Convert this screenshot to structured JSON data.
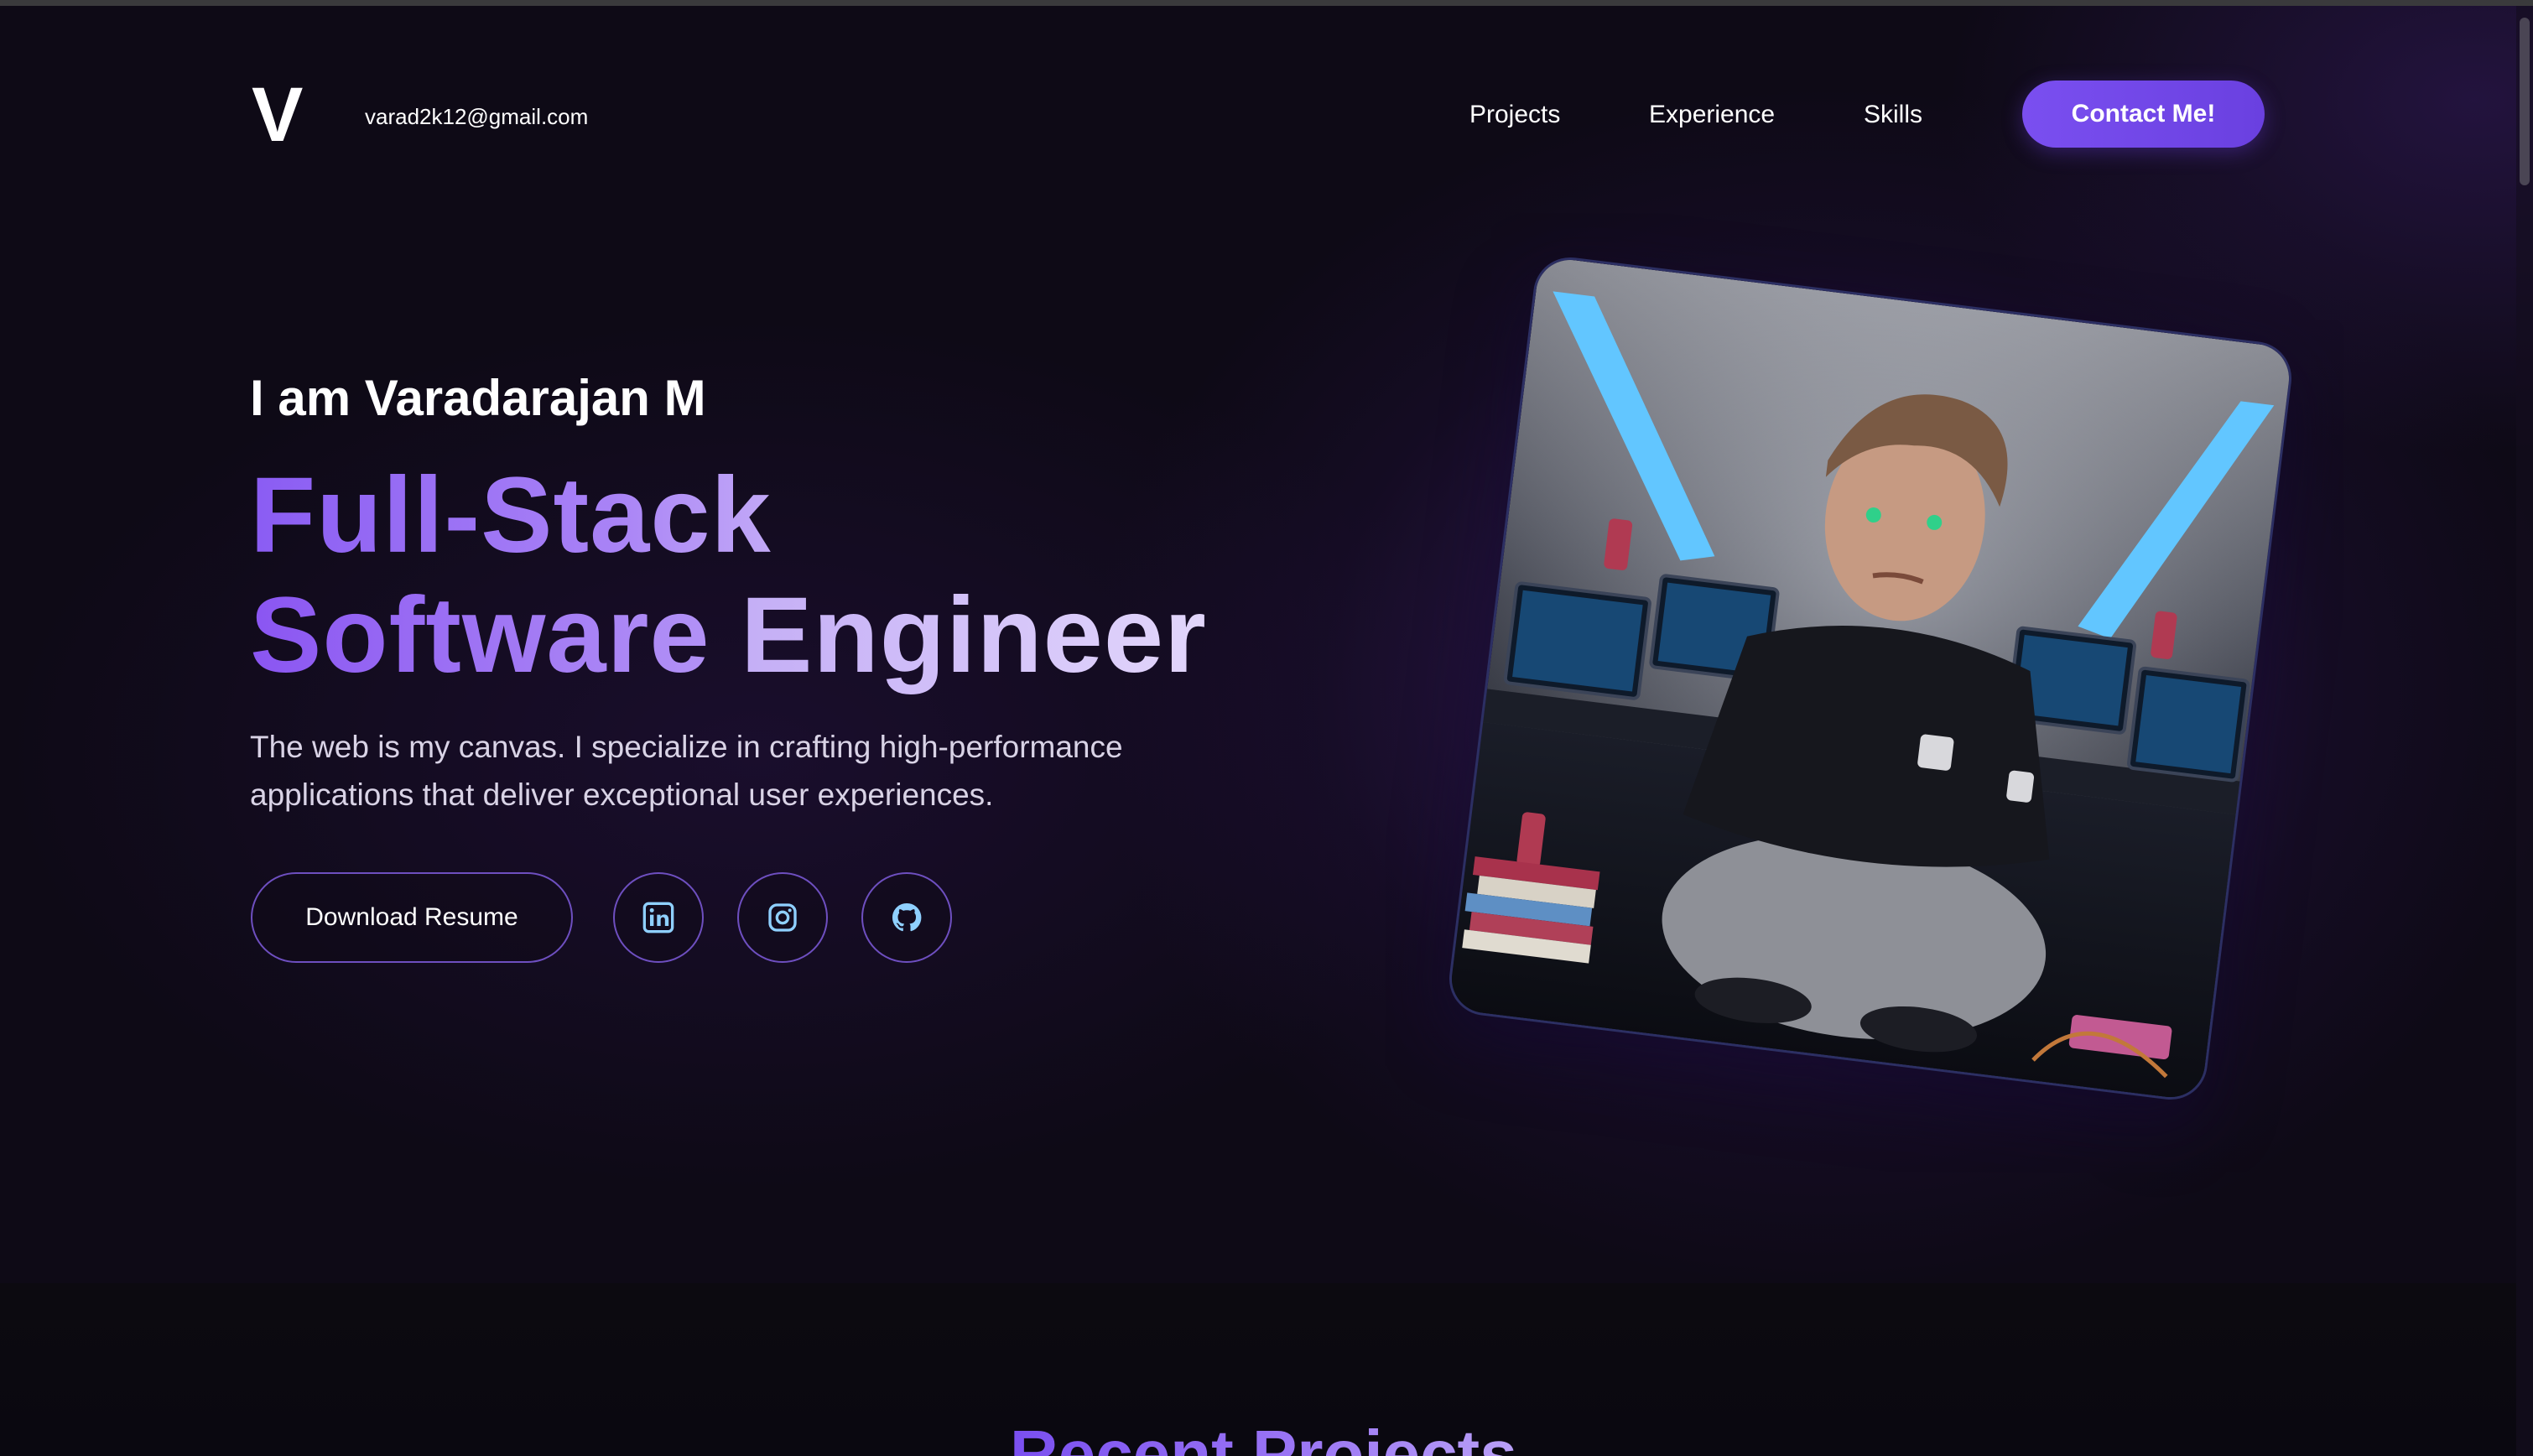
{
  "header": {
    "logo": "V",
    "email": "varad2k12@gmail.com",
    "nav": [
      {
        "label": "Projects"
      },
      {
        "label": "Experience"
      },
      {
        "label": "Skills"
      }
    ],
    "contact_label": "Contact Me!"
  },
  "hero": {
    "intro": "I am Varadarajan M",
    "headline_line1": "Full-Stack",
    "headline_line2_a": "Software ",
    "headline_line2_b": "Engineer",
    "description": "The web is my canvas. I specialize in crafting high-performance applications that deliver exceptional user experiences.",
    "resume_label": "Download Resume",
    "socials": [
      {
        "icon": "linkedin-icon"
      },
      {
        "icon": "instagram-icon"
      },
      {
        "icon": "github-icon"
      }
    ]
  },
  "next_section": {
    "title": "Recent Projects"
  },
  "colors": {
    "background": "#0e0a16",
    "accent": "#7a4ff0",
    "accent_light": "#b596f6",
    "outline": "#6e4fc0"
  }
}
